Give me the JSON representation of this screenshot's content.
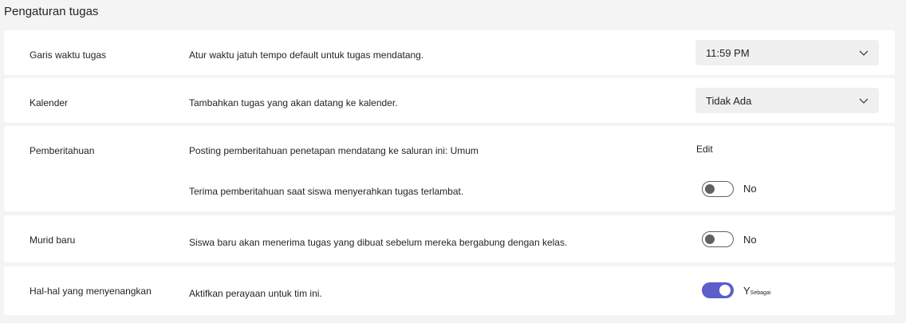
{
  "page": {
    "title": "Pengaturan tugas"
  },
  "colors": {
    "accent": "#5b5fc7",
    "card_bg": "#ffffff",
    "page_bg": "#f4f4f4",
    "toggle_off": "#616161"
  },
  "rows": {
    "deadline": {
      "label": "Garis waktu tugas",
      "description": "Atur waktu jatuh tempo default untuk tugas mendatang.",
      "value": "11:59 PM",
      "icon": "chevron-down-icon"
    },
    "calendar": {
      "label": "Kalender",
      "description": "Tambahkan tugas yang akan datang ke kalender.",
      "value": "Tidak Ada",
      "icon": "chevron-down-icon"
    },
    "notifications": {
      "label": "Pemberitahuan",
      "post_description": "Posting pemberitahuan penetapan mendatang ke saluran ini: Umum",
      "edit_label": "Edit",
      "late_description": "Terima pemberitahuan saat siswa menyerahkan tugas terlambat.",
      "late_toggle": {
        "state": false,
        "text": "No"
      }
    },
    "new_students": {
      "label": "Murid baru",
      "description": "Siswa baru akan menerima tugas yang dibuat sebelum mereka bergabung dengan kelas.",
      "toggle": {
        "state": false,
        "text": "No"
      }
    },
    "fun": {
      "label": "Hal-hal yang menyenangkan",
      "description": "Aktifkan perayaan untuk tim ini.",
      "toggle": {
        "state": true,
        "text_main": "Y",
        "text_small": "Sebagai"
      }
    }
  }
}
